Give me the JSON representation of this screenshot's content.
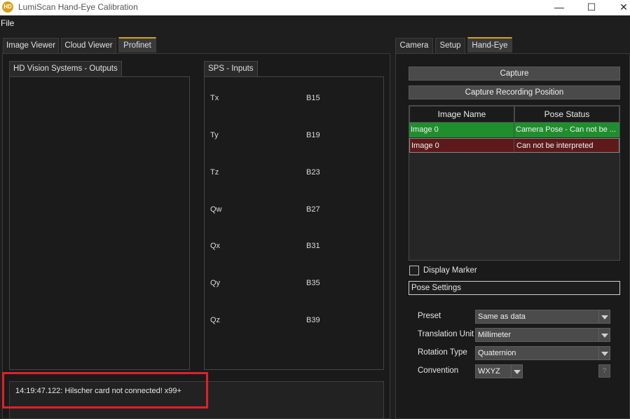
{
  "window": {
    "title": "LumiScan Hand-Eye Calibration",
    "logo_text": "HD",
    "minimize": "—",
    "maximize": "☐",
    "close": "✕"
  },
  "menu": {
    "file": "File"
  },
  "left_tabs": [
    "Image Viewer",
    "Cloud Viewer",
    "Profinet"
  ],
  "profinet": {
    "outputs_title": "HD Vision Systems - Outputs",
    "inputs_title": "SPS - Inputs",
    "inputs": [
      {
        "name": "Tx",
        "addr": "B15"
      },
      {
        "name": "Ty",
        "addr": "B19"
      },
      {
        "name": "Tz",
        "addr": "B23"
      },
      {
        "name": "Qw",
        "addr": "B27"
      },
      {
        "name": "Qx",
        "addr": "B31"
      },
      {
        "name": "Qy",
        "addr": "B35"
      },
      {
        "name": "Qz",
        "addr": "B39"
      }
    ]
  },
  "log": {
    "message": "14:19:47.122: Hilscher card not connected! x99+"
  },
  "right_tabs": [
    "Camera",
    "Setup",
    "Hand-Eye"
  ],
  "hand_eye": {
    "capture_label": "Capture",
    "capture_recording_label": "Capture Recording Position",
    "table": {
      "columns": [
        "Image Name",
        "Pose Status"
      ],
      "rows": [
        {
          "name": "Image 0",
          "status": "Camera Pose - Can not be ...",
          "color": "#1f8f2e"
        },
        {
          "name": "Image 0",
          "status": "Can not be interpreted",
          "color": "#5e1a1a"
        }
      ]
    },
    "display_marker_label": "Display Marker",
    "pose_settings_label": "Pose Settings",
    "settings": [
      {
        "label": "Preset",
        "value": "Same as data"
      },
      {
        "label": "Translation Unit",
        "value": "Millimeter"
      },
      {
        "label": "Rotation Type",
        "value": "Quaternion"
      },
      {
        "label": "Convention",
        "value": "WXYZ"
      }
    ],
    "help_label": "?"
  },
  "colors": {
    "accent": "#d4a21a",
    "highlight": "#e0202a"
  }
}
